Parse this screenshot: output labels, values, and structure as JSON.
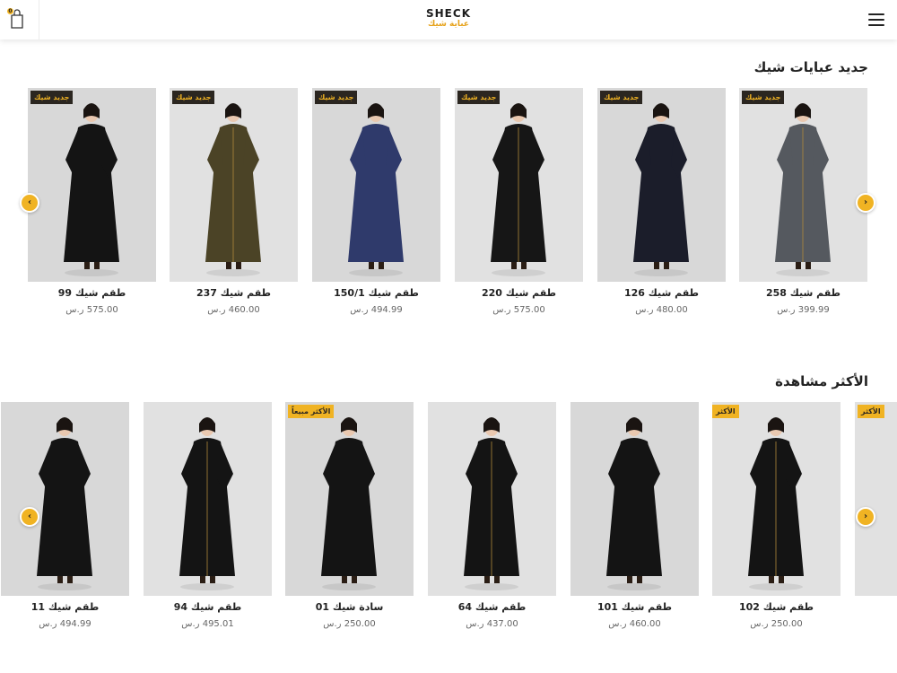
{
  "header": {
    "logo_en": "SHECK",
    "logo_ar": "عباية شيك",
    "cart_count": "0"
  },
  "colors": {
    "accent": "#f0b323",
    "badge_dark": "#2b2620",
    "card_bg": "#e1e1e1"
  },
  "sections": [
    {
      "title": "جديد عبايات شيك",
      "products": [
        {
          "name": "طقم شيك 258",
          "price": "399.99 ر.س",
          "badge": "جديد شيك",
          "color": "#55595f"
        },
        {
          "name": "طقم شيك 126",
          "price": "480.00 ر.س",
          "badge": "جديد شيك",
          "color": "#1b1d2a"
        },
        {
          "name": "طقم شيك 220",
          "price": "575.00 ر.س",
          "badge": "جديد شيك",
          "color": "#161616"
        },
        {
          "name": "طقم شيك 150/1",
          "price": "494.99 ر.س",
          "badge": "جديد شيك",
          "color": "#2f3a6b"
        },
        {
          "name": "طقم شيك 237",
          "price": "460.00 ر.س",
          "badge": "جديد شيك",
          "color": "#4b4326"
        },
        {
          "name": "طقم شيك 99",
          "price": "575.00 ر.س",
          "badge": "جديد شيك",
          "color": "#141414"
        }
      ]
    },
    {
      "title": "الأكثر مشاهدة",
      "products": [
        {
          "name": "طقم شيك 102",
          "price": "250.00 ر.س",
          "badge": "الأكثر",
          "color": "#141414"
        },
        {
          "name": "طقم شيك 101",
          "price": "460.00 ر.س",
          "badge": "",
          "color": "#141414"
        },
        {
          "name": "طقم شيك 64",
          "price": "437.00 ر.س",
          "badge": "",
          "color": "#141414"
        },
        {
          "name": "سادة شيك 01",
          "price": "250.00 ر.س",
          "badge": "الأكثر مبيعاً",
          "color": "#141414"
        },
        {
          "name": "طقم شيك 94",
          "price": "495.01 ر.س",
          "badge": "",
          "color": "#141414"
        },
        {
          "name": "طقم شيك 11",
          "price": "494.99 ر.س",
          "badge": "",
          "color": "#141414"
        }
      ]
    }
  ],
  "icons": {
    "cart": "shopping-bag-icon",
    "menu": "hamburger-menu-icon",
    "prev": "chevron-left-icon",
    "next": "chevron-right-icon"
  }
}
